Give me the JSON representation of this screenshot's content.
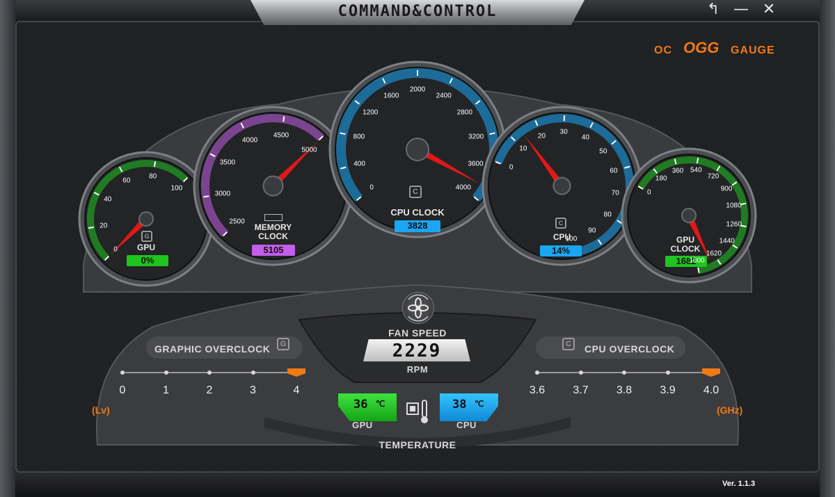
{
  "window": {
    "title": "COMMAND&CONTROL",
    "back_symbol": "↰",
    "minimize_symbol": "—",
    "close_symbol": "✕"
  },
  "brand": {
    "left": "OC",
    "middle": "OGG",
    "right": "GAUGE",
    "color": "#f07a14"
  },
  "colors": {
    "green": "#1fc41f",
    "purple": "#c35ee8",
    "blue": "#1aa6f5",
    "orange": "#f07a14"
  },
  "gauges": {
    "gpu": {
      "label": "GPU",
      "readout": "0%",
      "value": 0,
      "min": 0,
      "max": 100,
      "ticks": [
        "0",
        "20",
        "40",
        "60",
        "80",
        "100"
      ],
      "badge": "G",
      "color": "#1fc41f"
    },
    "memory": {
      "label_line1": "MEMORY",
      "label_line2": "CLOCK",
      "readout": "5105",
      "value": 5105,
      "min": 2500,
      "max": 5000,
      "ticks": [
        "2500",
        "3000",
        "3500",
        "4000",
        "4500",
        "5000"
      ],
      "color": "#c35ee8"
    },
    "cpu_clock": {
      "label": "CPU CLOCK",
      "readout": "3828",
      "value": 3828,
      "min": 0,
      "max": 4000,
      "ticks": [
        "0",
        "400",
        "800",
        "1200",
        "1600",
        "2000",
        "2400",
        "2800",
        "3200",
        "3600",
        "4000"
      ],
      "badge": "C",
      "color": "#1aa6f5"
    },
    "cpu": {
      "label": "CPU",
      "readout": "14%",
      "value": 14,
      "min": 0,
      "max": 100,
      "ticks": [
        "0",
        "10",
        "20",
        "30",
        "40",
        "50",
        "60",
        "70",
        "80",
        "90",
        "100"
      ],
      "badge": "C",
      "color": "#1aa6f5"
    },
    "gpu_clock": {
      "label_line1": "GPU",
      "label_line2": "CLOCK",
      "readout": "1682",
      "value": 1682,
      "min": 0,
      "max": 1800,
      "ticks": [
        "0",
        "180",
        "360",
        "540",
        "720",
        "900",
        "1080",
        "1260",
        "1440",
        "1620",
        "1800"
      ],
      "color": "#1fc41f"
    }
  },
  "fan": {
    "label": "FAN SPEED",
    "value": "2229",
    "unit": "RPM"
  },
  "graphic_overclock": {
    "title": "GRAPHIC OVERCLOCK",
    "badge": "G",
    "unit": "(Lv)",
    "levels": [
      "0",
      "1",
      "2",
      "3",
      "4"
    ],
    "selected_index": 4
  },
  "cpu_overclock": {
    "title": "CPU OVERCLOCK",
    "badge": "C",
    "unit": "(GHz)",
    "levels": [
      "3.6",
      "3.7",
      "3.8",
      "3.9",
      "4.0"
    ],
    "selected_index": 4
  },
  "temperature": {
    "label": "TEMPERATURE",
    "gpu_value": "36",
    "gpu_unit": "℃",
    "gpu_label": "GPU",
    "cpu_value": "38",
    "cpu_unit": "℃",
    "cpu_label": "CPU"
  },
  "version": "Ver. 1.1.3"
}
